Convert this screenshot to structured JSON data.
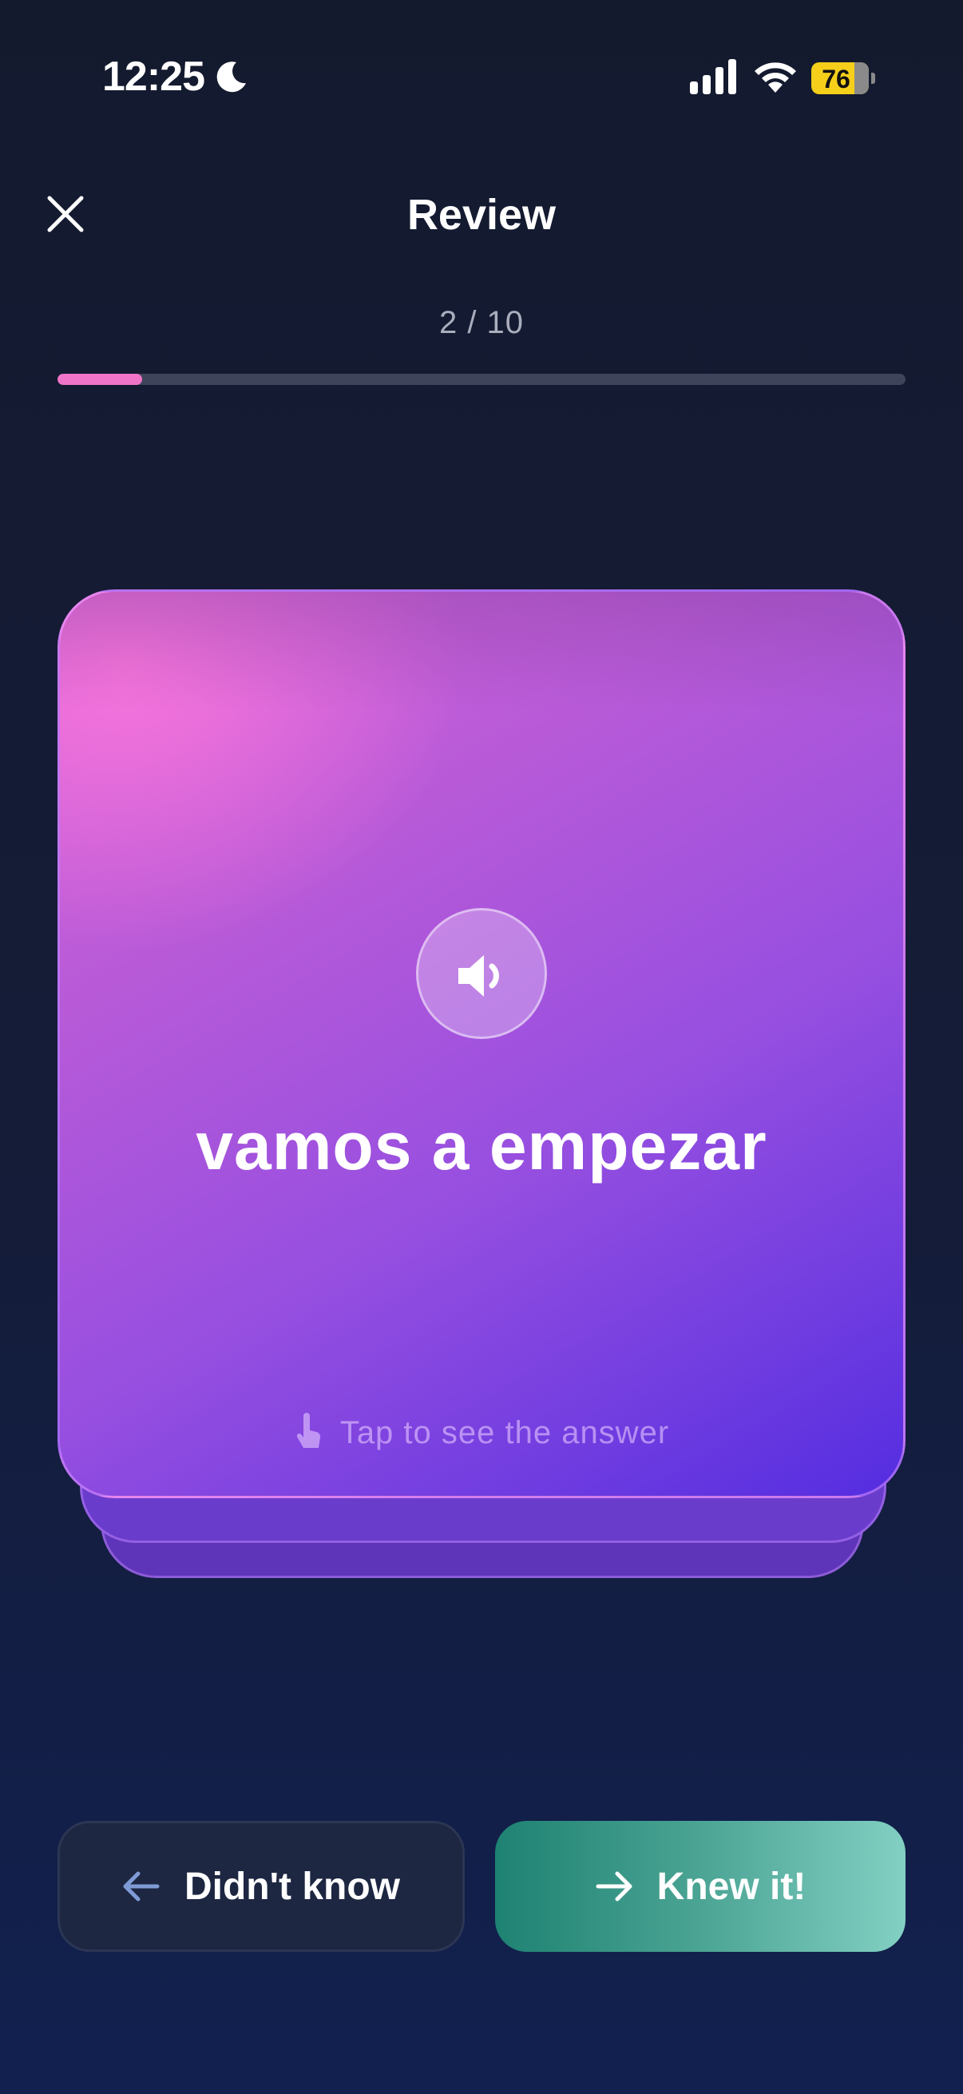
{
  "status_bar": {
    "time": "12:25",
    "battery": "76",
    "icons": [
      "moon-icon",
      "signal-icon",
      "wifi-icon",
      "battery-icon"
    ]
  },
  "header": {
    "title": "Review",
    "close_icon": "close-icon"
  },
  "progress": {
    "counter": "2 / 10",
    "current": 2,
    "total": 10,
    "fill_fraction": 0.1,
    "fill_color": "#f075c9"
  },
  "card": {
    "word": "vamos a empezar",
    "audio_icon": "speaker-icon",
    "hint": "Tap to see the answer",
    "hint_icon": "tap-hand-icon"
  },
  "actions": {
    "didnt_know_label": "Didn't know",
    "knew_it_label": "Knew it!"
  },
  "colors": {
    "accent_pink": "#f075c9",
    "success_teal": "#1e8272",
    "card_purple": "#974fe0"
  }
}
